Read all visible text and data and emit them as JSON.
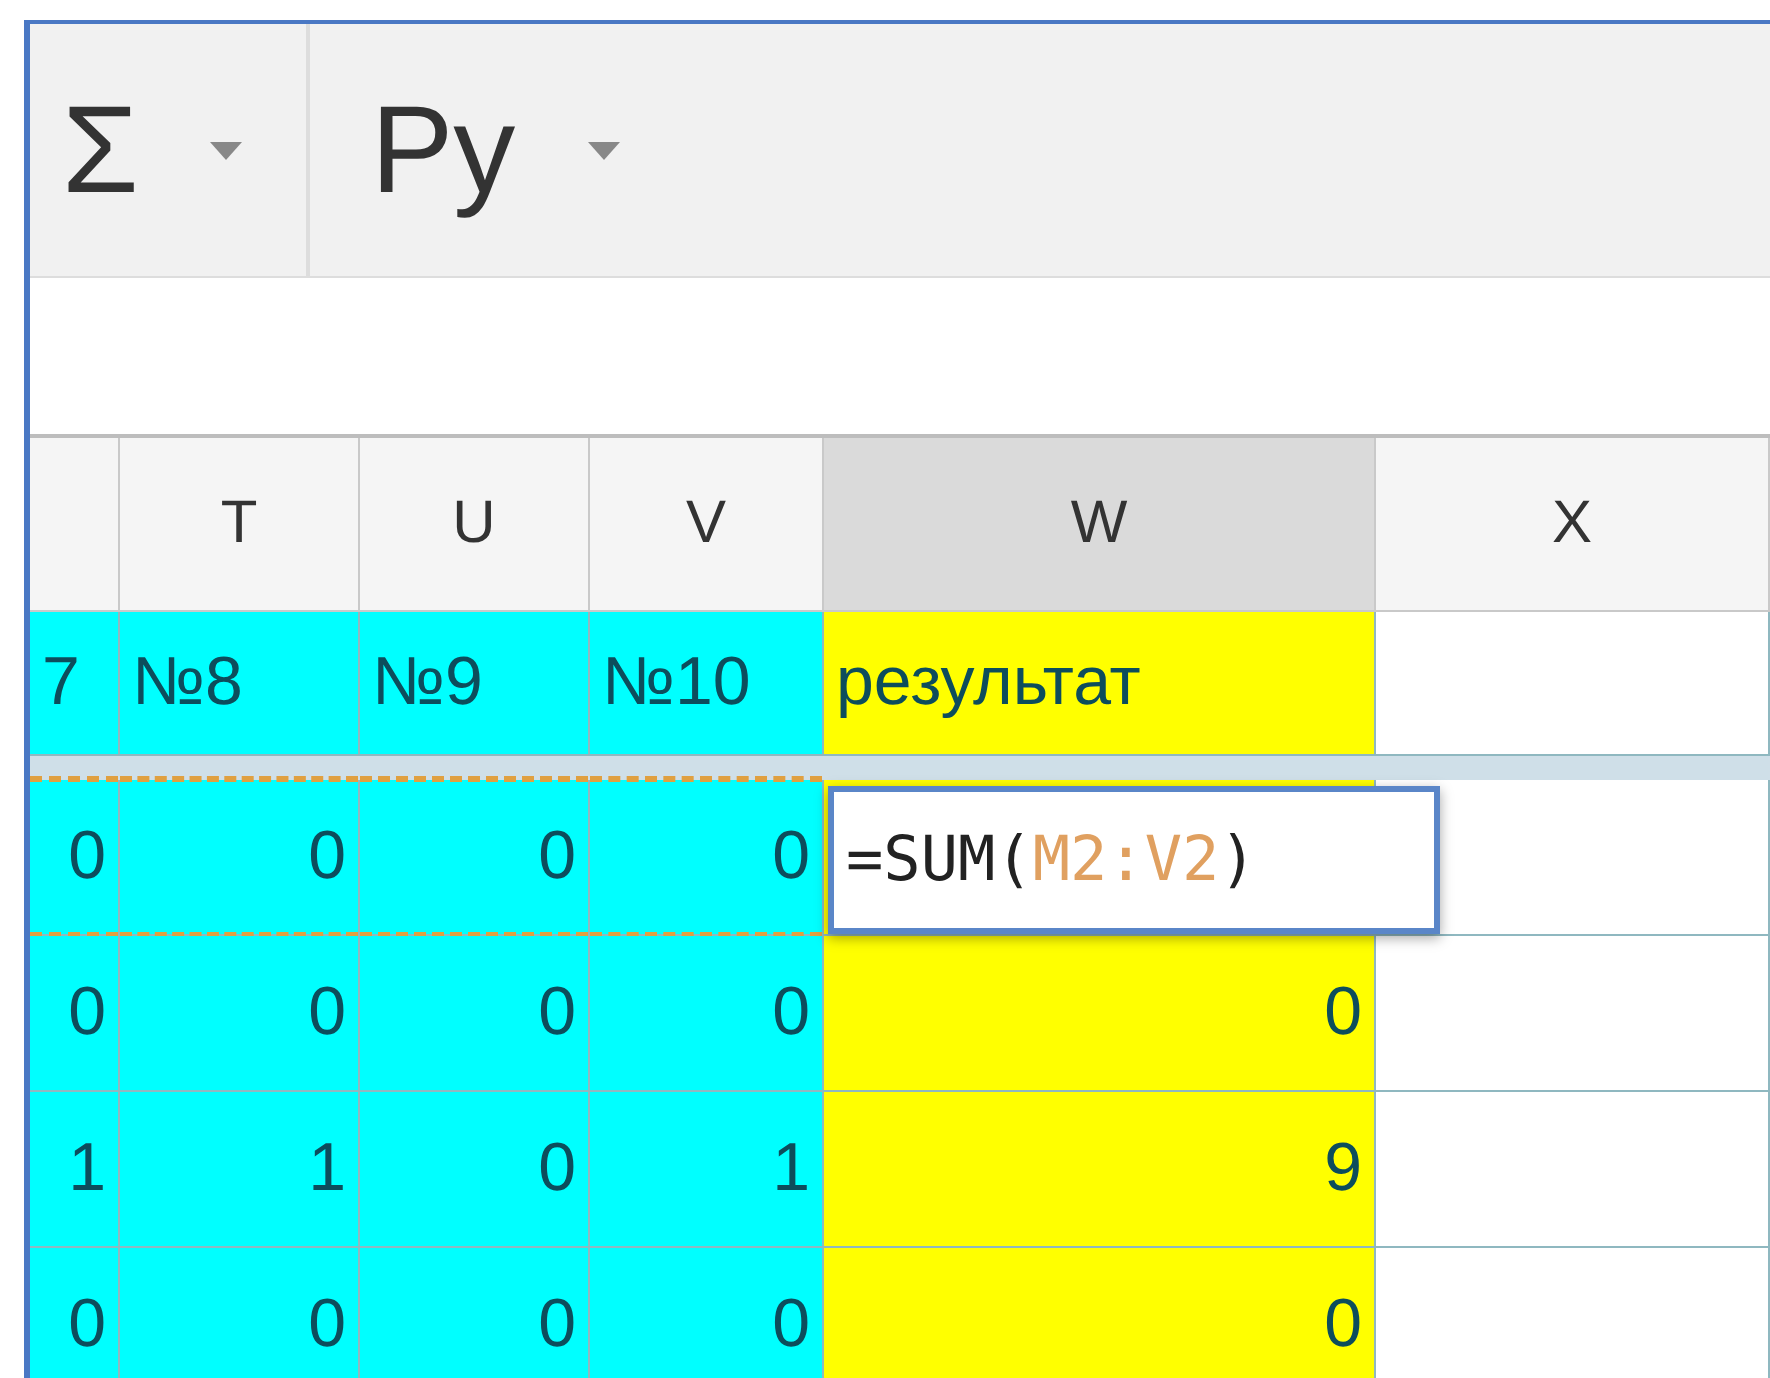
{
  "toolbar": {
    "buttons": [
      {
        "label": "Σ"
      },
      {
        "label": "Ру"
      }
    ]
  },
  "columns": [
    {
      "kind": "score",
      "selected": false
    },
    {
      "header": "T",
      "kind": "score",
      "selected": false
    },
    {
      "header": "U",
      "kind": "score",
      "selected": false
    },
    {
      "header": "V",
      "kind": "score",
      "selected": false
    },
    {
      "header": "W",
      "kind": "result",
      "selected": true
    },
    {
      "header": "X",
      "kind": "empty",
      "selected": false
    }
  ],
  "rows": [
    {
      "kind": "title",
      "copy_marquee": false,
      "cells": [
        "7",
        "№8",
        "№9",
        "№10",
        "результат",
        ""
      ]
    },
    {
      "kind": "number",
      "copy_marquee": true,
      "cells": [
        "0",
        "0",
        "0",
        "0",
        "",
        ""
      ],
      "editor": {
        "prefix": "=SUM(",
        "range": "M2:V2",
        "suffix": ")"
      }
    },
    {
      "kind": "number",
      "copy_marquee": false,
      "cells": [
        "0",
        "0",
        "0",
        "0",
        "0",
        ""
      ]
    },
    {
      "kind": "number",
      "copy_marquee": false,
      "cells": [
        "1",
        "1",
        "0",
        "1",
        "9",
        ""
      ]
    },
    {
      "kind": "number",
      "copy_marquee": false,
      "cells": [
        "0",
        "0",
        "0",
        "0",
        "0",
        ""
      ]
    }
  ]
}
